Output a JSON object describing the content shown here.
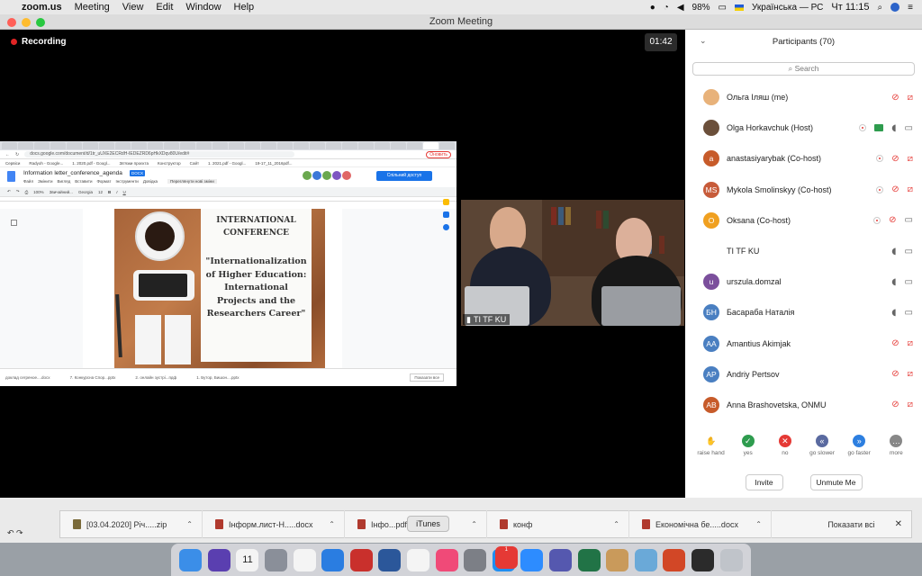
{
  "menubar": {
    "app": "zoom.us",
    "menus": [
      "Meeting",
      "View",
      "Edit",
      "Window",
      "Help"
    ],
    "battery": "98%",
    "keyboard": "Українська — РС",
    "clock": "Чт 11:15",
    "icons": [
      "apple-icon",
      "record-icon",
      "wifi-icon",
      "volume-icon",
      "battery-icon",
      "search-icon",
      "user-icon",
      "list-icon"
    ]
  },
  "window": {
    "title": "Zoom Meeting"
  },
  "video": {
    "recording_label": "Recording",
    "timer": "01:42",
    "camera_label": "TI TF KU"
  },
  "shared_doc": {
    "url": "docs.google.com/document/d/1tr_uUXE2ECRdH-IEDEZRD6pHkXDqv80U/edit#",
    "title": "Information letter_conference_agenda",
    "type_badge": "DOCX",
    "menu": [
      "Файл",
      "Змінити",
      "Вигляд",
      "Вставити",
      "Формат",
      "Інструменти",
      "Довідка"
    ],
    "last_edit": "Переглянути нові зміни",
    "share_label": "Спільний доступ",
    "zoom": "100%",
    "style": "Звичайний...",
    "font": "Georgia",
    "font_size": "12",
    "bookmarks": [
      "Сервіси",
      "Radyoh - Google...",
      "1. 2020.pdf - Googl...",
      "Зв'язки проєкта",
      "Конструктор",
      "Сайт",
      "1. 2021.pdf - Googl...",
      "19-17_11_2016pdf..."
    ],
    "refresh_label": "Оновить",
    "poster_heading": [
      "INTERNATIONAL",
      "CONFERENCE"
    ],
    "poster_quote": [
      "\"Internationalization",
      "of Higher Education:",
      "International",
      "Projects and the",
      "Researchers Career\""
    ],
    "downloads": [
      "доклад сегреное....docx",
      "7. Конкурсна Спор...pptx",
      "2. онлайн зустрі...пдф",
      "1. Бутор, Бишон....pptx"
    ],
    "show_all": "Показати все"
  },
  "participants": {
    "title": "Participants (70)",
    "search_placeholder": "Search",
    "people": [
      {
        "name": "Ольга Іляш (me)",
        "initials": "",
        "color": "#e8b27a",
        "mic": "off",
        "cam": "off",
        "rec": false,
        "share": false
      },
      {
        "name": "Olga Horkavchuk (Host)",
        "initials": "",
        "color": "#6b4f3a",
        "mic": "on",
        "cam": "on",
        "rec": true,
        "share": true
      },
      {
        "name": "anastasiyarybak (Co-host)",
        "initials": "a",
        "color": "#c75b2a",
        "mic": "off",
        "cam": "off",
        "rec": true,
        "share": false
      },
      {
        "name": "Mykola Smolinskyy (Co-host)",
        "initials": "MS",
        "color": "#c75b3a",
        "mic": "off",
        "cam": "off",
        "rec": true,
        "share": false
      },
      {
        "name": "Oksana (Co-host)",
        "initials": "O",
        "color": "#f0a020",
        "mic": "off",
        "cam": "on",
        "rec": true,
        "share": false
      },
      {
        "name": "TI TF KU",
        "initials": "",
        "color": "#ffffff",
        "mic": "on",
        "cam": "on",
        "rec": false,
        "share": false
      },
      {
        "name": "urszula.domzal",
        "initials": "u",
        "color": "#7b4f9c",
        "mic": "on",
        "cam": "on",
        "rec": false,
        "share": false
      },
      {
        "name": "Басараба Наталія",
        "initials": "БН",
        "color": "#4a7fc1",
        "mic": "on",
        "cam": "on",
        "rec": false,
        "share": false
      },
      {
        "name": "Amantius Akimjak",
        "initials": "AA",
        "color": "#4a7fc1",
        "mic": "off",
        "cam": "off",
        "rec": false,
        "share": false
      },
      {
        "name": "Andriy Pertsov",
        "initials": "AP",
        "color": "#4a7fc1",
        "mic": "off",
        "cam": "off",
        "rec": false,
        "share": false
      },
      {
        "name": "Anna Brashovetska, ONMU",
        "initials": "AB",
        "color": "#c75b2a",
        "mic": "off",
        "cam": "off",
        "rec": false,
        "share": false
      }
    ],
    "reactions": [
      {
        "label": "raise hand",
        "icon": "raise-hand-icon",
        "color": "#3b7ddd"
      },
      {
        "label": "yes",
        "icon": "check-icon",
        "color": "#2e9c4e"
      },
      {
        "label": "no",
        "icon": "x-icon",
        "color": "#e53935"
      },
      {
        "label": "go slower",
        "icon": "rewind-icon",
        "color": "#5a6aa0"
      },
      {
        "label": "go faster",
        "icon": "fast-forward-icon",
        "color": "#2d7fe0"
      },
      {
        "label": "more",
        "icon": "more-icon",
        "color": "#888888"
      }
    ],
    "invite_label": "Invite",
    "unmute_label": "Unmute Me"
  },
  "download_shelf": {
    "items": [
      {
        "name": "[03.04.2020] Річ.....zip"
      },
      {
        "name": "Інформ.лист-Н.....docx"
      },
      {
        "name": "Інфо...pdf"
      },
      {
        "name": "конф"
      },
      {
        "name": "Економічна бе.....docx"
      }
    ],
    "show_all": "Показати всі"
  },
  "tooltip": "iTunes",
  "dock": {
    "apps": [
      "finder-icon",
      "siri-icon",
      "calendar-icon",
      "launchpad-icon",
      "chrome-icon",
      "safari-icon",
      "acrobat-icon",
      "word-icon",
      "photos-icon",
      "itunes-icon",
      "system-prefs-icon",
      "appstore-icon",
      "zoom-icon",
      "teams-icon",
      "excel-icon",
      "archive-icon",
      "preview-icon",
      "powerpoint-icon",
      "photo-booth-icon",
      "trash-icon"
    ],
    "calendar_day": "11",
    "appstore_badge": "1"
  }
}
